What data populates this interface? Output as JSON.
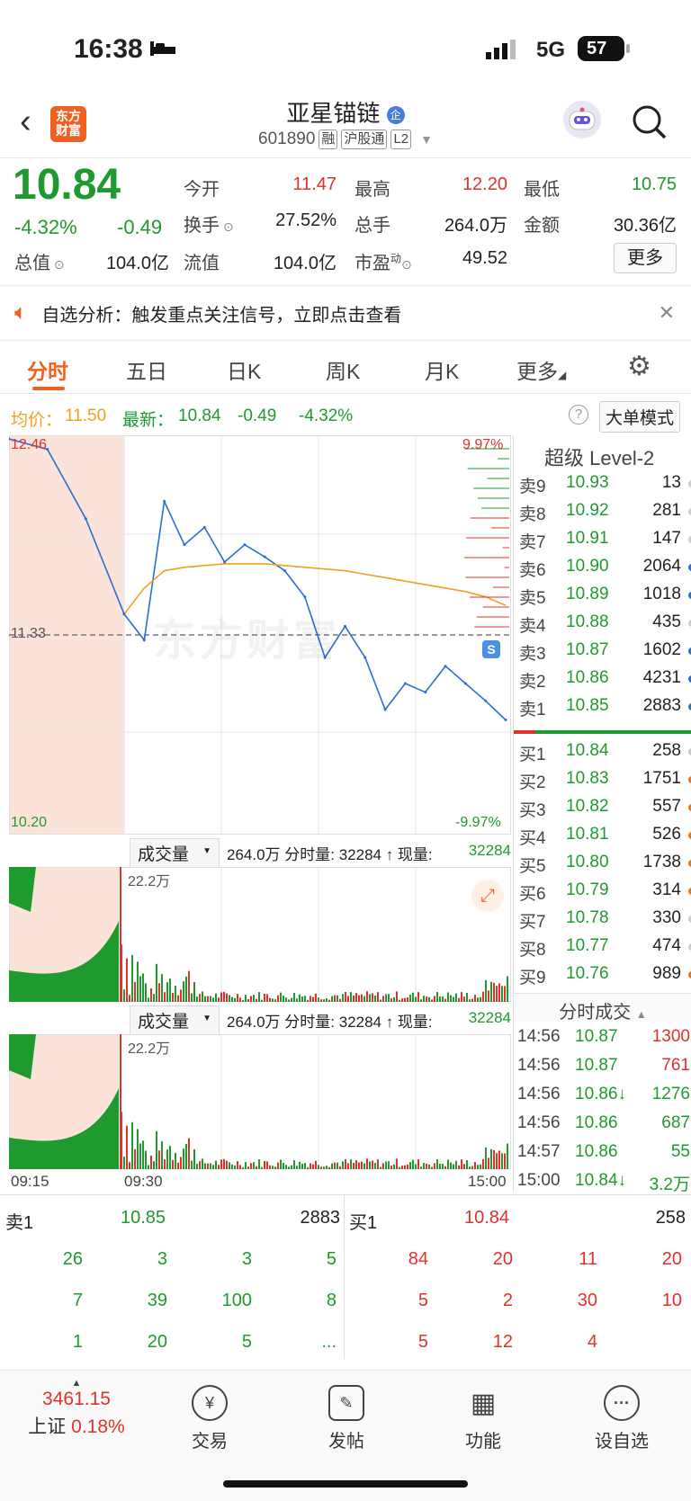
{
  "status_bar": {
    "time": "16:38",
    "network": "5G",
    "battery": "57"
  },
  "header": {
    "back_icon": "chevron-left-icon",
    "logo_line1": "东方",
    "logo_line2": "财富",
    "title": "亚星锚链",
    "title_badge": "企",
    "code": "601890",
    "tags": [
      "融",
      "沪股通",
      "L2"
    ]
  },
  "quote": {
    "price": "10.84",
    "change_pct": "-4.32%",
    "change": "-0.49",
    "open_label": "今开",
    "open": "11.47",
    "high_label": "最高",
    "high": "12.20",
    "low_label": "最低",
    "low": "10.75",
    "turnover_label": "换手",
    "turnover": "27.52%",
    "volume_label": "总手",
    "volume": "264.0万",
    "amount_label": "金额",
    "amount": "30.36亿",
    "mktcap_label": "总值",
    "mktcap": "104.0亿",
    "float_label": "流值",
    "float": "104.0亿",
    "pe_label": "市盈",
    "pe_sup": "动",
    "pe": "49.52",
    "more": "更多"
  },
  "alert": {
    "text": "自选分析：触发重点关注信号，立即点击查看"
  },
  "tabs": [
    "分时",
    "五日",
    "日K",
    "周K",
    "月K",
    "更多"
  ],
  "avg": {
    "avg_label": "均价：",
    "avg": "11.50",
    "latest_label": "最新：",
    "latest": "10.84",
    "chg": "-0.49",
    "pct": "-4.32%",
    "big_order": "大单模式"
  },
  "chart": {
    "y_top": "12.46",
    "y_mid": "11.33",
    "y_bot": "10.20",
    "pct_top": "9.97%",
    "pct_bot": "-9.97%",
    "watermark": "东方财富",
    "vol_panel_label": "成交量",
    "vol_info": "264.0万 分时量: 32284 ↑ 现量:",
    "vol_now": "32284",
    "vol_max": "22.2万",
    "time_start": "09:15",
    "time_open": "09:30",
    "time_end": "15:00"
  },
  "chart_data": {
    "type": "line",
    "title": "",
    "ylim": [
      10.2,
      12.46
    ],
    "prev_close": 11.33,
    "x": [
      "09:15",
      "09:20",
      "09:25",
      "09:30",
      "09:35",
      "09:40",
      "09:45",
      "09:50",
      "10:00",
      "10:15",
      "10:30",
      "10:45",
      "11:00",
      "11:15",
      "11:30",
      "13:15",
      "13:30",
      "13:45",
      "14:00",
      "14:15",
      "14:30",
      "14:45",
      "15:00"
    ],
    "series": [
      {
        "values": [
          12.46,
          12.4,
          12.0,
          11.45,
          11.3,
          12.1,
          11.85,
          11.95,
          11.75,
          11.85,
          11.78,
          11.7,
          11.55,
          11.2,
          11.38,
          11.2,
          10.9,
          11.05,
          11.0,
          11.15,
          11.05,
          10.95,
          10.84
        ]
      },
      {
        "values": [
          null,
          null,
          null,
          11.45,
          11.6,
          11.7,
          11.72,
          11.73,
          11.74,
          11.74,
          11.74,
          11.73,
          11.72,
          11.71,
          11.7,
          11.68,
          11.66,
          11.64,
          11.62,
          11.6,
          11.58,
          11.55,
          11.5
        ]
      }
    ]
  },
  "orderbook": {
    "title": "超级 Level-2",
    "sells": [
      {
        "label": "卖9",
        "price": "10.93",
        "vol": "13",
        "dot": "#cccccc"
      },
      {
        "label": "卖8",
        "price": "10.92",
        "vol": "281",
        "dot": "#cccccc"
      },
      {
        "label": "卖7",
        "price": "10.91",
        "vol": "147",
        "dot": "#cccccc"
      },
      {
        "label": "卖6",
        "price": "10.90",
        "vol": "2064",
        "dot": "#2a6fd0"
      },
      {
        "label": "卖5",
        "price": "10.89",
        "vol": "1018",
        "dot": "#2a6fd0"
      },
      {
        "label": "卖4",
        "price": "10.88",
        "vol": "435",
        "dot": "#cccccc"
      },
      {
        "label": "卖3",
        "price": "10.87",
        "vol": "1602",
        "dot": "#2a6fd0"
      },
      {
        "label": "卖2",
        "price": "10.86",
        "vol": "4231",
        "dot": "#2a6fd0"
      },
      {
        "label": "卖1",
        "price": "10.85",
        "vol": "2883",
        "dot": "#2a6fd0"
      }
    ],
    "buys": [
      {
        "label": "买1",
        "price": "10.84",
        "vol": "258",
        "dot": "#cccccc"
      },
      {
        "label": "买2",
        "price": "10.83",
        "vol": "1751",
        "dot": "#f07020"
      },
      {
        "label": "买3",
        "price": "10.82",
        "vol": "557",
        "dot": "#f07020"
      },
      {
        "label": "买4",
        "price": "10.81",
        "vol": "526",
        "dot": "#f07020"
      },
      {
        "label": "买5",
        "price": "10.80",
        "vol": "1738",
        "dot": "#f07020"
      },
      {
        "label": "买6",
        "price": "10.79",
        "vol": "314",
        "dot": "#f07020"
      },
      {
        "label": "买7",
        "price": "10.78",
        "vol": "330",
        "dot": "#cccccc"
      },
      {
        "label": "买8",
        "price": "10.77",
        "vol": "474",
        "dot": "#cccccc"
      },
      {
        "label": "买9",
        "price": "10.76",
        "vol": "989",
        "dot": "#f07020"
      }
    ],
    "trades_title": "分时成交",
    "trades": [
      {
        "time": "14:56",
        "price": "10.87",
        "vol": "1300",
        "color": "r"
      },
      {
        "time": "14:56",
        "price": "10.87",
        "vol": "761",
        "color": "r"
      },
      {
        "time": "14:56",
        "price": "10.86↓",
        "vol": "1276",
        "color": "g"
      },
      {
        "time": "14:56",
        "price": "10.86",
        "vol": "687",
        "color": "g"
      },
      {
        "time": "14:57",
        "price": "10.86",
        "vol": "55",
        "color": "g"
      },
      {
        "time": "15:00",
        "price": "10.84↓",
        "vol": "3.2万",
        "color": "g"
      }
    ]
  },
  "queue": {
    "sell_label": "卖1",
    "sell_price": "10.85",
    "sell_vol": "2883",
    "buy_label": "买1",
    "buy_price": "10.84",
    "buy_vol": "258",
    "sell_rows": [
      [
        "26",
        "3",
        "3",
        "5"
      ],
      [
        "7",
        "39",
        "100",
        "8"
      ],
      [
        "1",
        "20",
        "5",
        "..."
      ]
    ],
    "buy_rows": [
      [
        "84",
        "20",
        "11",
        "20"
      ],
      [
        "5",
        "2",
        "30",
        "10"
      ],
      [
        "5",
        "12",
        "4",
        ""
      ]
    ]
  },
  "bottom_nav": {
    "index_value": "3461.15",
    "index_name": "上证",
    "index_pct": "0.18%",
    "items": [
      {
        "label": "交易",
        "icon": "yen-exchange-icon",
        "glyph": "¥"
      },
      {
        "label": "发帖",
        "icon": "edit-post-icon",
        "glyph": "✎"
      },
      {
        "label": "功能",
        "icon": "grid-apps-icon",
        "glyph": "▦"
      },
      {
        "label": "设自选",
        "icon": "more-dots-icon",
        "glyph": "···"
      }
    ]
  }
}
